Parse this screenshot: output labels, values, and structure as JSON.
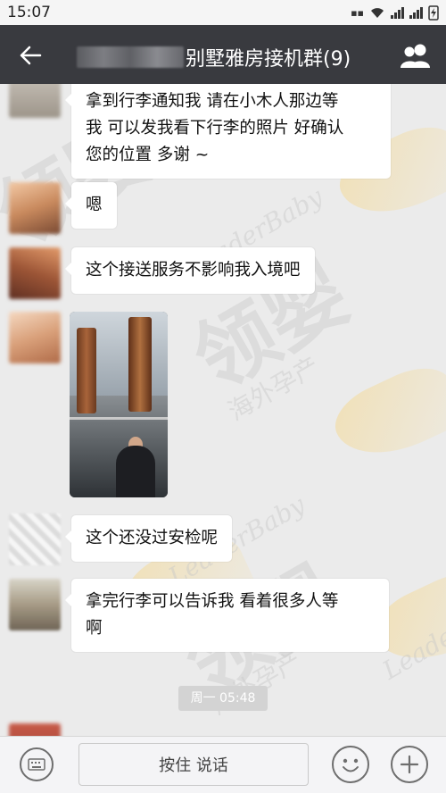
{
  "status_bar": {
    "time": "15:07",
    "indicators": [
      "signal-icon",
      "wifi-icon",
      "cell-signal-icon",
      "battery-charging-icon"
    ]
  },
  "header": {
    "title": "别墅雅房接机群(9)",
    "colors": {
      "background": "#393a3f",
      "text": "#ffffff"
    }
  },
  "messages": [
    {
      "sender_avatar": "blurred-avatar",
      "lines": [
        "拿到行李通知我 请在小木人那边等",
        "我 可以发我看下行李的照片 好确认",
        "您的位置 多谢 ~"
      ]
    },
    {
      "sender_avatar": "blurred-avatar",
      "text": "嗯"
    },
    {
      "sender_avatar": "blurred-avatar",
      "text": "这个接送服务不影响我入境吧"
    },
    {
      "sender_avatar": "blurred-avatar",
      "type": "image",
      "image_alt": "airport-arrival-hall-photo"
    },
    {
      "sender_avatar": "blurred-avatar",
      "text": "这个还没过安检呢"
    },
    {
      "sender_avatar": "blurred-avatar",
      "lines": [
        "拿完行李可以告诉我 看着很多人等",
        "啊"
      ]
    }
  ],
  "time_separator": "周一 05:48",
  "watermark": {
    "english": "LeaderBaby",
    "chinese": "领婴",
    "subtitle": "海外孕产"
  },
  "input_bar": {
    "hold_to_talk": "按住 说话"
  }
}
